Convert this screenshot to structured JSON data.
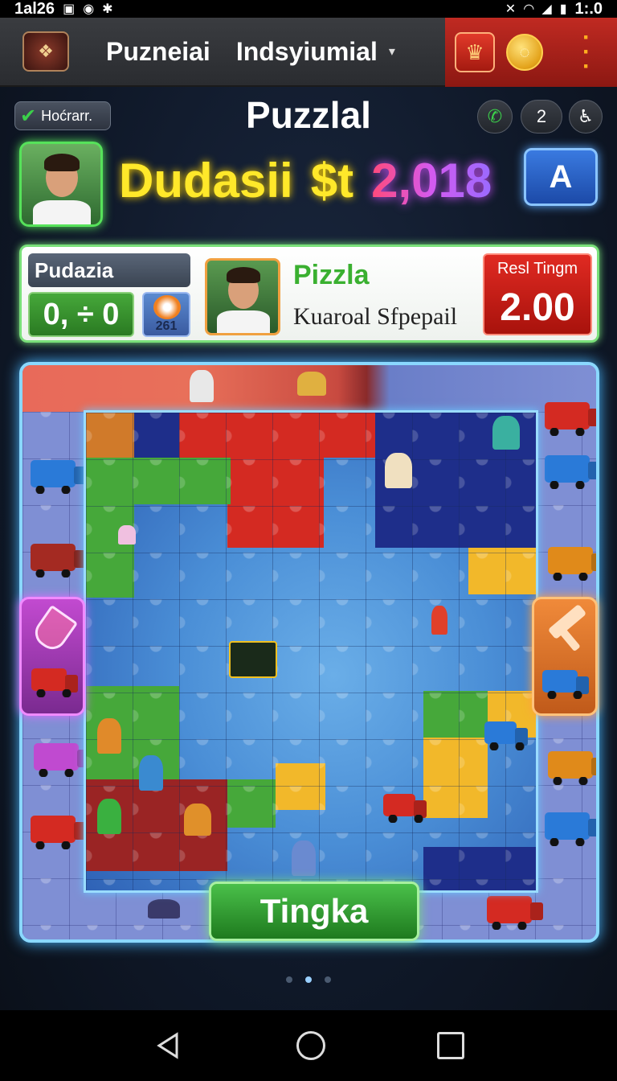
{
  "status_bar": {
    "time_left": "1al26",
    "time_right": "1:.0",
    "left_icons": [
      "network-icon",
      "shield-icon",
      "bug-icon"
    ],
    "right_icons": [
      "mute-icon",
      "wifi-icon",
      "signal-icon",
      "battery-icon"
    ]
  },
  "app_bar": {
    "title": "Puzneiai",
    "subtitle": "Indsyiumial",
    "dropdown_icon": "chevron-down-icon",
    "kebab_icon": "more-vert-icon"
  },
  "header": {
    "back_label": "Hoćrarr.",
    "page_title": "Puzzlal",
    "count": "2"
  },
  "hero": {
    "name": "Dudasii",
    "currency": "$t",
    "score": "2,018",
    "mode_button": "A"
  },
  "info_card": {
    "label": "Pudazia",
    "score": "0, ÷ 0",
    "mini_value": "261",
    "title": "Pizzla",
    "subtitle": "Kuaroal Sfpepail",
    "best_label": "Resl Tingm",
    "best_value": "2.00"
  },
  "actions": {
    "main_button": "Tingka"
  },
  "pager": {
    "pages": 3,
    "active": 1
  },
  "colors": {
    "accent_green": "#46a83a",
    "accent_red": "#d42a22",
    "board_glow": "#8ad8ff",
    "title_yellow": "#ffe82a"
  }
}
